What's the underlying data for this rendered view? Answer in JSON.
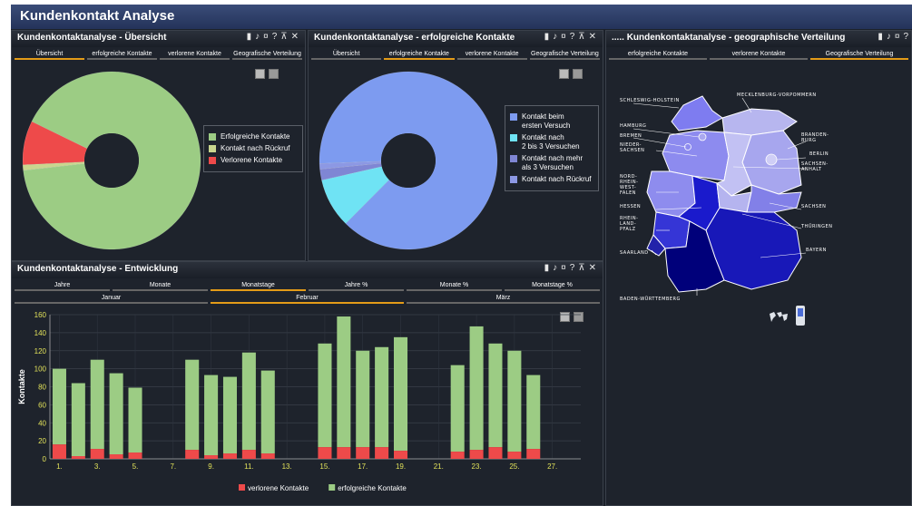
{
  "app": {
    "title": "Kundenkontakt Analyse"
  },
  "controls": {
    "c1": "▮",
    "c2": "♪",
    "c3": "¤",
    "c4": "?",
    "c5": "⊼",
    "c6": "✕",
    "ellipsis": "....."
  },
  "panel_overview": {
    "title": "Kundenkontaktanalyse - Übersicht",
    "tabs": [
      "Übersicht",
      "erfolgreiche Kontakte",
      "verlorene Kontakte",
      "Geografische Verteilung"
    ],
    "active_tab": 0,
    "legend": [
      {
        "label": "Erfolgreiche Kontakte",
        "color": "#9ccc84"
      },
      {
        "label": "Kontakt nach Rückruf",
        "color": "#c9d68e"
      },
      {
        "label": "Verlorene Kontakte",
        "color": "#ee4a4a"
      }
    ]
  },
  "panel_success": {
    "title": "Kundenkontaktanalyse - erfolgreiche Kontakte",
    "tabs": [
      "Übersicht",
      "erfolgreiche Kontakte",
      "verlorene Kontakte",
      "Geografische Verteilung"
    ],
    "active_tab": 1,
    "legend": [
      {
        "label": "Kontakt beim\nersten Versuch",
        "color": "#7d9bf0"
      },
      {
        "label": "Kontakt nach\n2 bis 3 Versuchen",
        "color": "#6fe3f4"
      },
      {
        "label": "Kontakt nach mehr\nals 3 Versuchen",
        "color": "#7f86d4"
      },
      {
        "label": "Kontakt nach Rückruf",
        "color": "#8c98e4"
      }
    ]
  },
  "panel_geo": {
    "title": "Kundenkontaktanalyse - geographische Verteilung",
    "tabs": [
      "erfolgreiche Kontakte",
      "verlorene Kontakte",
      "Geografische Verteilung"
    ],
    "active_tab": 2,
    "states": {
      "sh": "SCHLESWIG-HOLSTEIN",
      "mv": "MECKLENBURG-VORPOMMERN",
      "hh": "HAMBURG",
      "hb": "BREMEN",
      "ni": "NIEDER-\nSACHSEN",
      "bb": "BRANDEN-\nBURG",
      "be": "BERLIN",
      "st": "SACHSEN-\nANHALT",
      "nw": "NORD-\nRHEIN-\nWEST-\nFALEN",
      "he": "HESSEN",
      "sn": "SACHSEN",
      "rp": "RHEIN-\nLAND-\nPFALZ",
      "th": "THÜRINGEN",
      "sl": "SAARLAND",
      "by": "BAYERN",
      "bw": "BADEN-WÜRTTEMBERG"
    }
  },
  "panel_dev": {
    "title": "Kundenkontaktanalyse - Entwicklung",
    "tabs_row1": [
      "Jahre",
      "Monate",
      "Monatstage",
      "Jahre %",
      "Monate %",
      "Monatstage %"
    ],
    "active_tab_row1": 2,
    "tabs_row2": [
      "Januar",
      "Februar",
      "März"
    ],
    "active_tab_row2": 1,
    "legend": [
      {
        "label": "verlorene Kontakte",
        "color": "#ee4a4a"
      },
      {
        "label": "erfolgreiche Kontakte",
        "color": "#9ccc84"
      }
    ]
  },
  "chart_data": [
    {
      "type": "pie",
      "title": "",
      "labels": [
        "Erfolgreiche Kontakte",
        "Kontakt nach Rückruf",
        "Verlorene Kontakte"
      ],
      "values": [
        91,
        1,
        8
      ],
      "colors": [
        "#9ccc84",
        "#c9d68e",
        "#ee4a4a"
      ]
    },
    {
      "type": "pie",
      "title": "",
      "labels": [
        "Kontakt beim ersten Versuch",
        "Kontakt nach 2 bis 3 Versuchen",
        "Kontakt nach mehr als 3 Versuchen",
        "Kontakt nach Rückruf"
      ],
      "values": [
        88,
        9,
        2,
        1
      ],
      "colors": [
        "#7d9bf0",
        "#6fe3f4",
        "#7f86d4",
        "#8c98e4"
      ]
    },
    {
      "type": "bar",
      "stacked": true,
      "ylabel": "Kontakte",
      "ylim": [
        0,
        160
      ],
      "yticks": [
        0,
        20,
        40,
        60,
        80,
        100,
        120,
        140,
        160
      ],
      "x": [
        1,
        2,
        3,
        4,
        5,
        6,
        7,
        8,
        9,
        10,
        11,
        12,
        13,
        14,
        15,
        16,
        17,
        18,
        19,
        20,
        21,
        22,
        23,
        24,
        25,
        26,
        27,
        28
      ],
      "xticks": [
        "1.",
        "3.",
        "5.",
        "7.",
        "9.",
        "11.",
        "13.",
        "15.",
        "17.",
        "19.",
        "21.",
        "23.",
        "25.",
        "27."
      ],
      "series": [
        {
          "name": "verlorene Kontakte",
          "color": "#ee4a4a",
          "values": [
            16,
            3,
            11,
            5,
            7,
            0,
            0,
            10,
            4,
            6,
            10,
            6,
            0,
            0,
            13,
            13,
            13,
            13,
            9,
            0,
            0,
            8,
            10,
            13,
            8,
            11,
            0,
            0
          ]
        },
        {
          "name": "erfolgreiche Kontakte",
          "color": "#9ccc84",
          "values": [
            84,
            81,
            99,
            90,
            72,
            0,
            0,
            100,
            89,
            85,
            108,
            92,
            0,
            0,
            115,
            145,
            107,
            111,
            126,
            0,
            0,
            96,
            137,
            115,
            112,
            82,
            0,
            0
          ]
        }
      ]
    }
  ]
}
